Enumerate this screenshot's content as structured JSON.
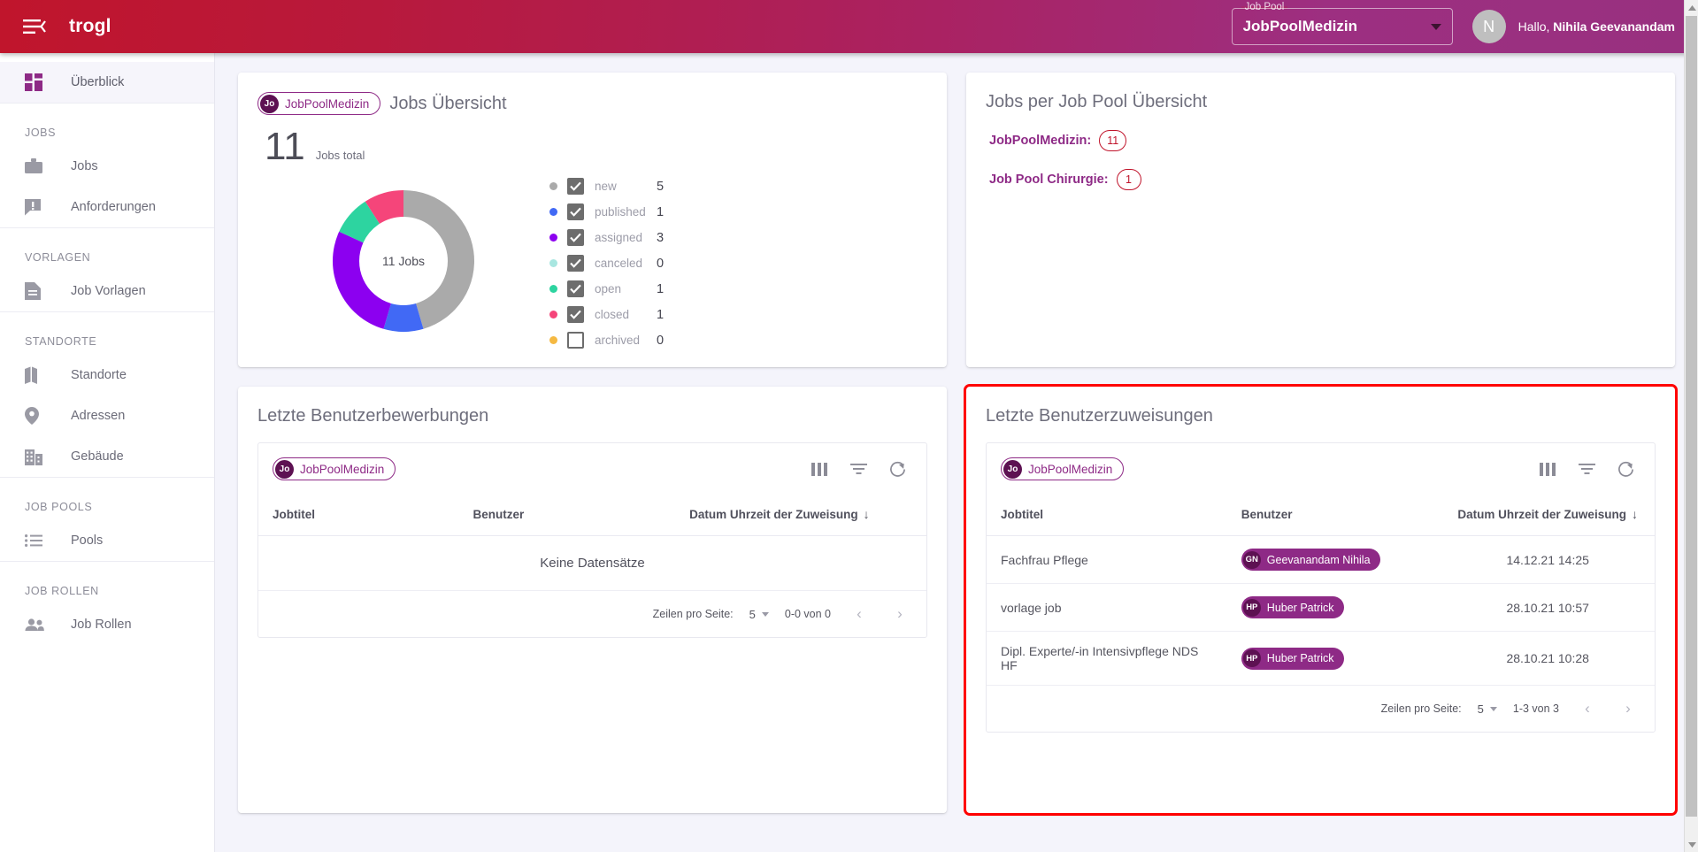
{
  "topbar": {
    "menu_icon": "hamburger-menu-icon",
    "brand": "trogl",
    "job_pool_label": "Job Pool",
    "job_pool_value": "JobPoolMedizin",
    "avatar_initial": "N",
    "greeting_prefix": "Hallo, ",
    "user_name": "Nihila Geevanandam"
  },
  "sidebar": {
    "overview": {
      "label": "Überblick",
      "icon": "dashboard-icon"
    },
    "groups": [
      {
        "title": "JOBS",
        "items": [
          {
            "label": "Jobs",
            "icon": "briefcase-icon"
          },
          {
            "label": "Anforderungen",
            "icon": "announcement-icon"
          }
        ]
      },
      {
        "title": "VORLAGEN",
        "items": [
          {
            "label": "Job Vorlagen",
            "icon": "document-icon"
          }
        ]
      },
      {
        "title": "STANDORTE",
        "items": [
          {
            "label": "Standorte",
            "icon": "map-icon"
          },
          {
            "label": "Adressen",
            "icon": "location-pin-icon"
          },
          {
            "label": "Gebäude",
            "icon": "building-icon"
          }
        ]
      },
      {
        "title": "JOB POOLS",
        "items": [
          {
            "label": "Pools",
            "icon": "list-icon"
          }
        ]
      },
      {
        "title": "JOB ROLLEN",
        "items": [
          {
            "label": "Job Rollen",
            "icon": "people-icon"
          }
        ]
      }
    ]
  },
  "jobs_overview": {
    "chip_initials": "Jo",
    "chip_label": "JobPoolMedizin",
    "title": "Jobs Übersicht",
    "total": "11",
    "total_label": "Jobs total",
    "donut_center": "11 Jobs"
  },
  "chart_data": {
    "type": "pie",
    "title": "Jobs Übersicht",
    "center_label": "11 Jobs",
    "total": 11,
    "categories": [
      "new",
      "published",
      "assigned",
      "canceled",
      "open",
      "closed",
      "archived"
    ],
    "values": [
      5,
      1,
      3,
      0,
      1,
      1,
      0
    ],
    "colors": [
      "#aaaaaa",
      "#4169f5",
      "#8c00f0",
      "#a8e6e0",
      "#2dd4a0",
      "#f5457a",
      "#f5b942"
    ],
    "enabled": [
      true,
      true,
      true,
      true,
      true,
      true,
      false
    ],
    "legend_position": "right",
    "donut": true,
    "xlabel": "",
    "ylabel": ""
  },
  "pools_overview": {
    "title": "Jobs per Job Pool Übersicht",
    "rows": [
      {
        "name": "JobPoolMedizin:",
        "count": "11"
      },
      {
        "name": "Job Pool Chirurgie:",
        "count": "1"
      }
    ]
  },
  "applications_card": {
    "title": "Letzte Benutzerbewerbungen",
    "chip_initials": "Jo",
    "chip_label": "JobPoolMedizin",
    "toolbar_icons": [
      "columns-icon",
      "filter-icon",
      "refresh-icon"
    ],
    "columns": [
      "Jobtitel",
      "Benutzer",
      "Datum Uhrzeit der Zuweisung"
    ],
    "sort_arrow": "↓",
    "empty_text": "Keine Datensätze",
    "footer": {
      "rows_per_page_label": "Zeilen pro Seite:",
      "rows_per_page_value": "5",
      "range": "0-0 von 0",
      "prev_icon": "chevron-left-icon",
      "next_icon": "chevron-right-icon"
    }
  },
  "assignments_card": {
    "title": "Letzte Benutzerzuweisungen",
    "chip_initials": "Jo",
    "chip_label": "JobPoolMedizin",
    "toolbar_icons": [
      "columns-icon",
      "filter-icon",
      "refresh-icon"
    ],
    "columns": [
      "Jobtitel",
      "Benutzer",
      "Datum Uhrzeit der Zuweisung"
    ],
    "sort_arrow": "↓",
    "rows": [
      {
        "job": "Fachfrau Pflege",
        "user_initials": "GN",
        "user": "Geevanandam Nihila",
        "date": "14.12.21 14:25"
      },
      {
        "job": "vorlage job",
        "user_initials": "HP",
        "user": "Huber Patrick",
        "date": "28.10.21 10:57"
      },
      {
        "job": "Dipl. Experte/-in Intensivpflege NDS HF",
        "user_initials": "HP",
        "user": "Huber Patrick",
        "date": "28.10.21 10:28"
      }
    ],
    "footer": {
      "rows_per_page_label": "Zeilen pro Seite:",
      "rows_per_page_value": "5",
      "range": "1-3 von 3",
      "prev_icon": "chevron-left-icon",
      "next_icon": "chevron-right-icon"
    },
    "highlight_color": "#ff0000"
  },
  "theme": {
    "header_left": "#c0152c",
    "header_right": "#98307f",
    "accent_purple": "#8e2a86",
    "accent_red": "#c0152c"
  }
}
